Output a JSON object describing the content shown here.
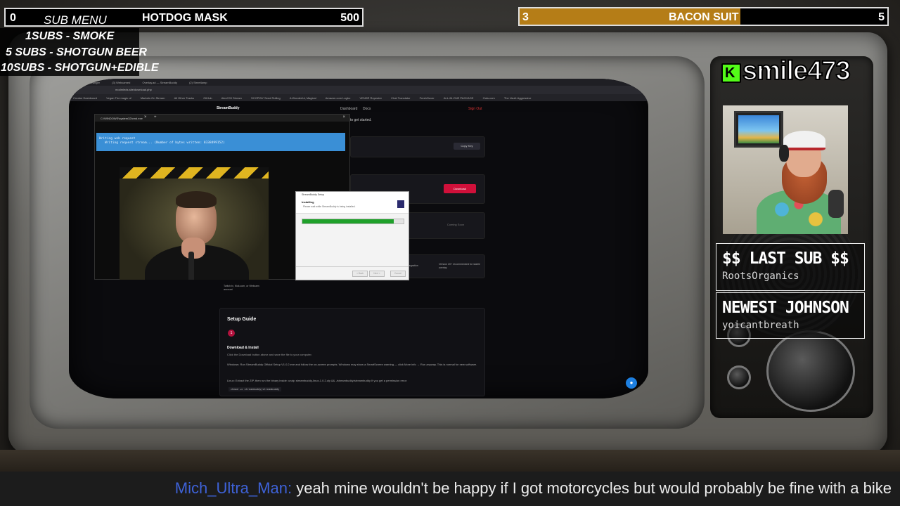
{
  "goals": {
    "left": {
      "current": "0",
      "label": "SUB MENU",
      "title": "HOTDOG MASK",
      "target": "500"
    },
    "right": {
      "current": "3",
      "title": "BACON SUIT",
      "target": "5",
      "progress_fraction": 0.6,
      "fill_color": "#b57d17"
    }
  },
  "sub_menu": {
    "items": [
      "1SUBS   - SMOKE",
      "5 SUBS  - SHOTGUN BEER",
      "10SUBS - SHOTGUN+EDIBLE"
    ]
  },
  "streamer": {
    "username": "smile473",
    "platform_icon": "kick-icon",
    "platform_letter": "K",
    "brand_color": "#53fc18"
  },
  "last_sub": {
    "title": "$$ LAST SUB $$",
    "name": "RootsOrganics"
  },
  "newest": {
    "title": "NEWEST JOHNSON",
    "name": "yoicantbreath"
  },
  "chat": {
    "user": "Mich_Ultra_Man",
    "separator": ":",
    "message": "yeah mine wouldn't be happy if I got motorcycles but would probably be fine with a bike",
    "user_color": "#3e62d8"
  },
  "screen": {
    "browser": {
      "tabs": [
        "(2) Ripping Stranger",
        "(3) Webcamed",
        "Overlay.ad — StreamBuddy",
        "(2) Streetlamp"
      ],
      "address": "modmleds.site/download.php",
      "bookmarks": [
        "Creator Dashboard",
        "Vegan The magic of",
        "Markets On Stream",
        "All Other Tracks",
        "GitHub",
        "AlexC99 Stream",
        "SCOPINY Seed Rolling",
        "A Wonderful, Magical",
        "Amazon.com Logbo",
        "VENDR Repeater",
        "Chat Translator",
        "FreshGuver",
        "ALL-IN-ONE PACKAGE",
        "Outs.com",
        "The Vault: Aggressive"
      ]
    },
    "site": {
      "brand": "StreamBuddy",
      "nav": {
        "dashboard": "Dashboard",
        "docs": "Docs",
        "signout": "Sign Out"
      },
      "get_started": "to get started.",
      "copy_key": "Copy Key",
      "download": "Download",
      "coming_soon": "Coming Soon",
      "version_note": "Version 20+ recommended for stable overlay",
      "integration": "integration",
      "twitch_note": "Twitch.tv, Kick.com, or Webcam account",
      "guide": {
        "title": "Setup Guide",
        "step": "1",
        "heading": "Download & Install",
        "p1": "Click the Download button above and save the file to your computer.",
        "p2": "Windows: Run StreamBuddy Official Setup V1.0.2.exe and follow the on-screen prompts. Windows may show a SmartScreen warning — click More info → Run anyway. This is normal for new software.",
        "p3": "Linux: Extract the ZIP, then run the binary inside: unzip streambuddy-linux-1.0.2.zip && ./streambuddy/streambuddy  If you get a permission error:",
        "code": "chmod +x streambuddy/streambuddy"
      }
    },
    "terminal": {
      "title": "C:\\WINDOWS\\system32\\cmd.exe",
      "line1": "Writing web request",
      "line2": "Writing request stream... (Number of bytes written: 8338499152)"
    },
    "installer": {
      "title": "StreamBuddy Setup",
      "heading": "Installing",
      "sub": "Please wait while StreamBuddy is being installed.",
      "progress_fraction": 0.9,
      "buttons": [
        "< Back",
        "Next >",
        "Cancel"
      ]
    }
  },
  "colors": {
    "accent_red": "#d0103a",
    "progress_green": "#1fa02a",
    "banner_blue": "#3a8fd6"
  }
}
